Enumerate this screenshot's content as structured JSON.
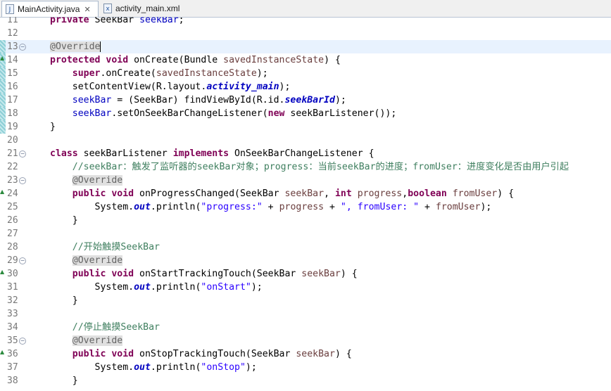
{
  "tabs": [
    {
      "label": "MainActivity.java",
      "icon": "java-file-icon",
      "active": true,
      "closable": true
    },
    {
      "label": "activity_main.xml",
      "icon": "xml-file-icon",
      "active": false,
      "closable": false
    }
  ],
  "lines": [
    {
      "n": "11",
      "gutter": false,
      "fold": "",
      "override": false,
      "current": false,
      "seg": [
        [
          "kw",
          "private "
        ],
        [
          "",
          "SeekBar "
        ],
        [
          "fld",
          "seekBar"
        ],
        [
          "",
          ";"
        ]
      ]
    },
    {
      "n": "12",
      "gutter": false,
      "fold": "",
      "override": false,
      "current": false,
      "seg": []
    },
    {
      "n": "13",
      "gutter": true,
      "fold": "⊖",
      "override": false,
      "current": true,
      "caret": true,
      "seg": [
        [
          "ann",
          "@Override"
        ]
      ]
    },
    {
      "n": "14",
      "gutter": true,
      "fold": "",
      "override": true,
      "current": false,
      "seg": [
        [
          "kw",
          "protected "
        ],
        [
          "kw",
          "void "
        ],
        [
          "",
          "onCreate(Bundle "
        ],
        [
          "param",
          "savedInstanceState"
        ],
        [
          "",
          ") {"
        ]
      ]
    },
    {
      "n": "15",
      "gutter": true,
      "fold": "",
      "override": false,
      "current": false,
      "seg": [
        [
          "",
          "    "
        ],
        [
          "kw",
          "super"
        ],
        [
          "",
          ".onCreate("
        ],
        [
          "param",
          "savedInstanceState"
        ],
        [
          "",
          ");"
        ]
      ]
    },
    {
      "n": "16",
      "gutter": true,
      "fold": "",
      "override": false,
      "current": false,
      "seg": [
        [
          "",
          "    setContentView(R.layout."
        ],
        [
          "stfld",
          "activity_main"
        ],
        [
          "",
          ");"
        ]
      ]
    },
    {
      "n": "17",
      "gutter": true,
      "fold": "",
      "override": false,
      "current": false,
      "seg": [
        [
          "",
          "    "
        ],
        [
          "fld",
          "seekBar"
        ],
        [
          "",
          " = (SeekBar) findViewById(R.id."
        ],
        [
          "stfld",
          "seekBarId"
        ],
        [
          "",
          ");"
        ]
      ]
    },
    {
      "n": "18",
      "gutter": true,
      "fold": "",
      "override": false,
      "current": false,
      "seg": [
        [
          "",
          "    "
        ],
        [
          "fld",
          "seekBar"
        ],
        [
          "",
          ".setOnSeekBarChangeListener("
        ],
        [
          "kw",
          "new "
        ],
        [
          "",
          "seekBarListener());"
        ]
      ]
    },
    {
      "n": "19",
      "gutter": true,
      "fold": "",
      "override": false,
      "current": false,
      "seg": [
        [
          "",
          "}"
        ]
      ]
    },
    {
      "n": "20",
      "gutter": false,
      "fold": "",
      "override": false,
      "current": false,
      "seg": []
    },
    {
      "n": "21",
      "gutter": false,
      "fold": "⊖",
      "override": false,
      "current": false,
      "seg": [
        [
          "kw",
          "class "
        ],
        [
          "",
          "seekBarListener "
        ],
        [
          "kw",
          "implements "
        ],
        [
          "",
          "OnSeekBarChangeListener {"
        ]
      ]
    },
    {
      "n": "22",
      "gutter": false,
      "fold": "",
      "override": false,
      "current": false,
      "seg": [
        [
          "",
          "    "
        ],
        [
          "cmt",
          "//seekBar：触发了监听器的seekBar对象；progress：当前seekBar的进度；fromUser：进度变化是否由用户引起"
        ]
      ]
    },
    {
      "n": "23",
      "gutter": false,
      "fold": "⊖",
      "override": false,
      "current": false,
      "seg": [
        [
          "",
          "    "
        ],
        [
          "ann",
          "@Override"
        ]
      ]
    },
    {
      "n": "24",
      "gutter": false,
      "fold": "",
      "override": true,
      "current": false,
      "seg": [
        [
          "",
          "    "
        ],
        [
          "kw",
          "public "
        ],
        [
          "kw",
          "void "
        ],
        [
          "",
          "onProgressChanged(SeekBar "
        ],
        [
          "param",
          "seekBar"
        ],
        [
          "",
          ", "
        ],
        [
          "kw",
          "int "
        ],
        [
          "param",
          "progress"
        ],
        [
          "",
          ","
        ],
        [
          "kw",
          "boolean "
        ],
        [
          "param",
          "fromUser"
        ],
        [
          "",
          ") {"
        ]
      ]
    },
    {
      "n": "25",
      "gutter": false,
      "fold": "",
      "override": false,
      "current": false,
      "seg": [
        [
          "",
          "        System."
        ],
        [
          "stout",
          "out"
        ],
        [
          "",
          ".println("
        ],
        [
          "str",
          "\"progress:\""
        ],
        [
          "",
          " + "
        ],
        [
          "param",
          "progress"
        ],
        [
          "",
          " + "
        ],
        [
          "str",
          "\", fromUser: \""
        ],
        [
          "",
          " + "
        ],
        [
          "param",
          "fromUser"
        ],
        [
          "",
          ");"
        ]
      ]
    },
    {
      "n": "26",
      "gutter": false,
      "fold": "",
      "override": false,
      "current": false,
      "seg": [
        [
          "",
          "    }"
        ]
      ]
    },
    {
      "n": "27",
      "gutter": false,
      "fold": "",
      "override": false,
      "current": false,
      "seg": []
    },
    {
      "n": "28",
      "gutter": false,
      "fold": "",
      "override": false,
      "current": false,
      "seg": [
        [
          "",
          "    "
        ],
        [
          "cmt",
          "//开始触摸SeekBar"
        ]
      ]
    },
    {
      "n": "29",
      "gutter": false,
      "fold": "⊖",
      "override": false,
      "current": false,
      "seg": [
        [
          "",
          "    "
        ],
        [
          "ann",
          "@Override"
        ]
      ]
    },
    {
      "n": "30",
      "gutter": false,
      "fold": "",
      "override": true,
      "current": false,
      "seg": [
        [
          "",
          "    "
        ],
        [
          "kw",
          "public "
        ],
        [
          "kw",
          "void "
        ],
        [
          "",
          "onStartTrackingTouch(SeekBar "
        ],
        [
          "param",
          "seekBar"
        ],
        [
          "",
          ") {"
        ]
      ]
    },
    {
      "n": "31",
      "gutter": false,
      "fold": "",
      "override": false,
      "current": false,
      "seg": [
        [
          "",
          "        System."
        ],
        [
          "stout",
          "out"
        ],
        [
          "",
          ".println("
        ],
        [
          "str",
          "\"onStart\""
        ],
        [
          "",
          ");"
        ]
      ]
    },
    {
      "n": "32",
      "gutter": false,
      "fold": "",
      "override": false,
      "current": false,
      "seg": [
        [
          "",
          "    }"
        ]
      ]
    },
    {
      "n": "33",
      "gutter": false,
      "fold": "",
      "override": false,
      "current": false,
      "seg": []
    },
    {
      "n": "34",
      "gutter": false,
      "fold": "",
      "override": false,
      "current": false,
      "seg": [
        [
          "",
          "    "
        ],
        [
          "cmt",
          "//停止触摸SeekBar"
        ]
      ]
    },
    {
      "n": "35",
      "gutter": false,
      "fold": "⊖",
      "override": false,
      "current": false,
      "seg": [
        [
          "",
          "    "
        ],
        [
          "ann",
          "@Override"
        ]
      ]
    },
    {
      "n": "36",
      "gutter": false,
      "fold": "",
      "override": true,
      "current": false,
      "seg": [
        [
          "",
          "    "
        ],
        [
          "kw",
          "public "
        ],
        [
          "kw",
          "void "
        ],
        [
          "",
          "onStopTrackingTouch(SeekBar "
        ],
        [
          "param",
          "seekBar"
        ],
        [
          "",
          ") {"
        ]
      ]
    },
    {
      "n": "37",
      "gutter": false,
      "fold": "",
      "override": false,
      "current": false,
      "seg": [
        [
          "",
          "        System."
        ],
        [
          "stout",
          "out"
        ],
        [
          "",
          ".println("
        ],
        [
          "str",
          "\"onStop\""
        ],
        [
          "",
          ");"
        ]
      ]
    },
    {
      "n": "38",
      "gutter": false,
      "fold": "",
      "override": false,
      "current": false,
      "seg": [
        [
          "",
          "    }"
        ]
      ]
    }
  ]
}
